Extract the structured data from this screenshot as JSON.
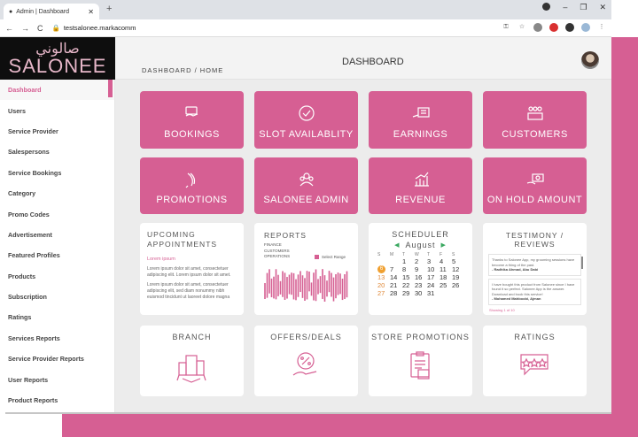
{
  "browser": {
    "tab_title": "Admin | Dashboard",
    "url": "testsalonee.markacomm"
  },
  "logo": {
    "arabic": "صالوني",
    "english": "SALONEE"
  },
  "header": {
    "breadcrumb": "DASHBOARD /  HOME",
    "title": "DASHBOARD"
  },
  "sidebar": {
    "items": [
      {
        "label": "Dashboard"
      },
      {
        "label": "Users"
      },
      {
        "label": "Service Provider"
      },
      {
        "label": "Salespersons"
      },
      {
        "label": "Service Bookings"
      },
      {
        "label": "Category"
      },
      {
        "label": "Promo Codes"
      },
      {
        "label": "Advertisement"
      },
      {
        "label": "Featured Profiles"
      },
      {
        "label": "Products"
      },
      {
        "label": "Subscription"
      },
      {
        "label": "Ratings"
      },
      {
        "label": "Services Reports"
      },
      {
        "label": "Service Provider Reports"
      },
      {
        "label": "User Reports"
      },
      {
        "label": "Product Reports"
      }
    ]
  },
  "cards": {
    "bookings": "BOOKINGS",
    "slot": "SLOT AVAILABLITY",
    "earnings": "EARNINGS",
    "customers": "CUSTOMERS",
    "promotions": "PROMOTIONS",
    "admin": "SALONEE ADMIN",
    "revenue": "REVENUE",
    "onhold": "ON HOLD AMOUNT",
    "branch": "BRANCH",
    "offers": "OFFERS/DEALS",
    "store": "STORE PROMOTIONS",
    "ratings": "RATINGS"
  },
  "upcoming": {
    "title": "UPCOMING APPOINTMENTS",
    "sub": "Lorem ipsum",
    "p1": "Lorem ipsum dolor sit amet, consectetuer adipiscing elit. Lorem ipsum dolor sit amet.",
    "p2": "Lorem ipsum dolor sit amet, consectetuer adipiscing elit, sed diam nonummy nibh euismod tincidunt ut laoreet dolore magna"
  },
  "reports": {
    "title": "REPORTS",
    "l1": "FINANCE",
    "l2": "CUSTOMERS",
    "l3": "OPERATIONS",
    "range": "Select Range"
  },
  "scheduler": {
    "title": "SCHEDULER",
    "month": "August",
    "days": [
      "S",
      "M",
      "T",
      "W",
      "T",
      "F",
      "S"
    ],
    "rows": [
      [
        "",
        "",
        "1",
        "2",
        "3",
        "4",
        "5"
      ],
      [
        "6",
        "7",
        "8",
        "9",
        "10",
        "11",
        "12"
      ],
      [
        "13",
        "14",
        "15",
        "16",
        "17",
        "18",
        "19"
      ],
      [
        "20",
        "21",
        "22",
        "23",
        "24",
        "25",
        "26"
      ],
      [
        "27",
        "28",
        "29",
        "30",
        "31",
        "",
        ""
      ]
    ]
  },
  "testimony": {
    "title": "TESTIMONY / REVIEWS",
    "q1": "Thanks to Salonee App, my grooming sessions have become a thing of the past.",
    "a1": "- Radhika Ahmad, Abu Dabi",
    "q2": "I have bought this product from Salonee since I have found it so perfect. Salonee App is the answer. Download and book this service!",
    "a2": "- Mohamed Mahboobi, Ajman",
    "link": "Showing 1 of 10"
  },
  "colors": {
    "accent": "#d65f93"
  }
}
